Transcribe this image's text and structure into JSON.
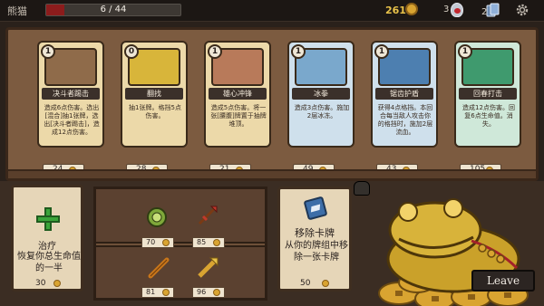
{
  "player": {
    "name": "熊猫",
    "hp_text": "6 / 44",
    "hp_fraction": 0.136
  },
  "currency": {
    "gold": "261",
    "potions": "3",
    "deck": "29"
  },
  "icons": {
    "gold": "gold-coin-icon",
    "potion": "potion-flask-icon",
    "deck": "deck-cards-icon",
    "settings": "gear-icon",
    "hand": "pointing-hand-icon"
  },
  "cards": [
    {
      "name": "决斗者踢击",
      "cost": "1",
      "desc": "造成6点伤害。选出[混合]抽1张牌，选出[决斗者踢击]，造成12点伤害。",
      "price": "24",
      "style": "gold",
      "art_color": "#8f6b4a"
    },
    {
      "name": "翻找",
      "cost": "0",
      "desc": "抽1张牌。格挡5点伤害。",
      "price": "28",
      "style": "gold",
      "art_color": "#d8b53a"
    },
    {
      "name": "雄心冲锋",
      "cost": "1",
      "desc": "造成5点伤害。将一张[腰腹]牌置于抽牌堆顶。",
      "price": "21",
      "style": "gold",
      "art_color": "#b87a5a"
    },
    {
      "name": "冰拳",
      "cost": "1",
      "desc": "造成3点伤害。施加2层冰冻。",
      "price": "49",
      "style": "blue",
      "art_color": "#7aa8cc"
    },
    {
      "name": "锯齿护盾",
      "cost": "1",
      "desc": "获得4点格挡。本回合每当敌人攻击你的格挡时，施加2层流血。",
      "price": "43",
      "style": "blue",
      "art_color": "#4d7fb0"
    },
    {
      "name": "回春打击",
      "cost": "1",
      "desc": "造成12点伤害。回复6点生命值。消失。",
      "price": "105",
      "style": "green",
      "art_color": "#3f9a6e"
    }
  ],
  "services": {
    "heal": {
      "title": "治疗",
      "desc": "恢复你总生命值的一半",
      "price": "30"
    },
    "remove": {
      "title": "移除卡牌",
      "desc": "从你的牌组中移除一张卡牌",
      "price": "50"
    }
  },
  "relics": [
    {
      "name": "green-orb-relic",
      "price": "70",
      "color": "#7fa83a"
    },
    {
      "name": "red-spear-relic",
      "price": "85",
      "color": "#c0392b"
    },
    {
      "name": "baton-relic",
      "price": "81",
      "color": "#c8761a"
    },
    {
      "name": "golden-arrow-relic",
      "price": "96",
      "color": "#d9a431"
    }
  ],
  "leave_label": "Leave"
}
